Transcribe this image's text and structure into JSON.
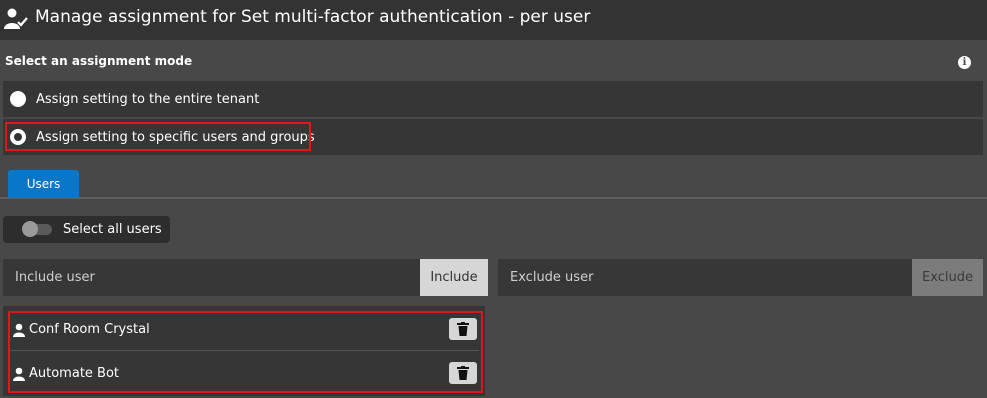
{
  "header": {
    "title": "Manage assignment for Set multi-factor authentication - per user",
    "icon": "user-check-icon"
  },
  "mode": {
    "label": "Select an assignment mode",
    "info_icon": "info-icon",
    "options": [
      {
        "label": "Assign setting to the entire tenant",
        "selected": false
      },
      {
        "label": "Assign setting to specific users and groups",
        "selected": true
      }
    ]
  },
  "tabs": [
    {
      "label": "Users",
      "active": true
    }
  ],
  "select_all": {
    "label": "Select all users",
    "enabled": false
  },
  "include": {
    "placeholder": "Include user",
    "button": "Include"
  },
  "exclude": {
    "placeholder": "Exclude user",
    "button": "Exclude"
  },
  "users": [
    {
      "name": "Conf Room Crystal",
      "icon": "user-icon",
      "action_icon": "trash-icon"
    },
    {
      "name": "Automate Bot",
      "icon": "user-icon",
      "action_icon": "trash-icon"
    }
  ],
  "colors": {
    "accent": "#0877c9",
    "highlight": "#e0161b",
    "background": "#484848",
    "header": "#333333"
  }
}
